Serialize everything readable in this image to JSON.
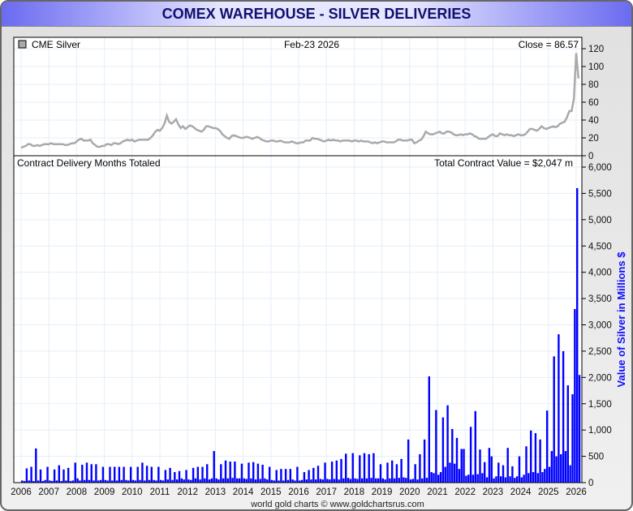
{
  "title": "COMEX WAREHOUSE - SILVER DELIVERIES",
  "footer": "world gold charts © www.goldchartsrus.com",
  "chart_data": [
    {
      "type": "line",
      "legend": "CME Silver",
      "date_label": "Feb-23  2026",
      "close_label": "Close = 86.57",
      "color": "#aaaaaa",
      "ylim": [
        0,
        120
      ],
      "yticks": [
        0,
        20,
        40,
        60,
        80,
        100,
        120
      ],
      "start_year": 2006,
      "monthly_values": [
        [
          9,
          10,
          11,
          13,
          13,
          11,
          11,
          12,
          11,
          12,
          13,
          13
        ],
        [
          13,
          14,
          13,
          13,
          13,
          13,
          13,
          12,
          12,
          13,
          14,
          14
        ],
        [
          16,
          18,
          19,
          17,
          17,
          17,
          18,
          14,
          12,
          10,
          10,
          11
        ],
        [
          11,
          13,
          13,
          12,
          14,
          14,
          13,
          14,
          16,
          17,
          18,
          17
        ],
        [
          18,
          16,
          17,
          18,
          18,
          18,
          18,
          18,
          20,
          23,
          27,
          29
        ],
        [
          28,
          31,
          36,
          45,
          38,
          36,
          38,
          41,
          35,
          31,
          33,
          30
        ],
        [
          32,
          34,
          33,
          31,
          29,
          28,
          27,
          29,
          33,
          33,
          32,
          31
        ],
        [
          31,
          30,
          28,
          24,
          22,
          20,
          19,
          22,
          23,
          22,
          21,
          20
        ],
        [
          20,
          21,
          21,
          20,
          19,
          20,
          21,
          20,
          18,
          17,
          16,
          16
        ],
        [
          17,
          17,
          16,
          16,
          17,
          16,
          15,
          15,
          15,
          16,
          15,
          14
        ],
        [
          14,
          15,
          15,
          17,
          17,
          17,
          20,
          19,
          19,
          18,
          17,
          16
        ],
        [
          17,
          18,
          17,
          18,
          17,
          17,
          16,
          17,
          17,
          17,
          17,
          16
        ],
        [
          17,
          17,
          16,
          17,
          16,
          16,
          16,
          15,
          14,
          15,
          14,
          15
        ],
        [
          16,
          16,
          15,
          15,
          15,
          15,
          16,
          18,
          18,
          17,
          17,
          17
        ],
        [
          18,
          18,
          14,
          15,
          17,
          18,
          22,
          27,
          25,
          24,
          24,
          25
        ],
        [
          26,
          27,
          25,
          25,
          27,
          27,
          26,
          24,
          23,
          23,
          24,
          23
        ],
        [
          24,
          24,
          25,
          24,
          22,
          21,
          19,
          19,
          19,
          19,
          21,
          23
        ],
        [
          24,
          22,
          22,
          25,
          24,
          23,
          24,
          23,
          23,
          22,
          23,
          24
        ],
        [
          23,
          23,
          24,
          27,
          30,
          30,
          29,
          28,
          30,
          33,
          31,
          30
        ],
        [
          31,
          32,
          33,
          32,
          33,
          36,
          37,
          38,
          43,
          50,
          50,
          64
        ],
        [
          115,
          86.57
        ]
      ]
    },
    {
      "type": "bar",
      "title": "Contract Delivery Months Totaled",
      "total_label": "Total Contract Value = $2,047 m",
      "ylabel": "Value of Silver in Millions $",
      "color": "#0000ff",
      "ylim": [
        0,
        6000
      ],
      "yticks": [
        "0",
        "500",
        "1,000",
        "1,500",
        "2,000",
        "2,500",
        "3,000",
        "3,500",
        "4,000",
        "4,500",
        "5,000",
        "5,500",
        "6,000"
      ],
      "xticks": [
        "2006",
        "2007",
        "2008",
        "2009",
        "2010",
        "2011",
        "2012",
        "2013",
        "2014",
        "2015",
        "2016",
        "2017",
        "2018",
        "2019",
        "2020",
        "2021",
        "2022",
        "2023",
        "2024",
        "2025",
        "2026"
      ],
      "start_year": 2006,
      "monthly_values": [
        [
          40,
          30,
          270,
          40,
          300,
          30,
          650,
          40,
          250,
          30,
          50,
          300
        ],
        [
          40,
          30,
          250,
          40,
          330,
          30,
          250,
          40,
          280,
          30,
          40,
          380
        ],
        [
          80,
          40,
          340,
          50,
          380,
          50,
          350,
          40,
          350,
          40,
          50,
          300
        ],
        [
          50,
          40,
          300,
          40,
          300,
          40,
          300,
          50,
          300,
          50,
          40,
          300
        ],
        [
          50,
          40,
          300,
          50,
          380,
          40,
          320,
          50,
          300,
          50,
          40,
          300
        ],
        [
          50,
          40,
          240,
          60,
          280,
          50,
          200,
          60,
          220,
          80,
          60,
          240
        ],
        [
          60,
          50,
          280,
          80,
          300,
          60,
          300,
          80,
          350,
          60,
          80,
          600
        ],
        [
          80,
          60,
          350,
          80,
          420,
          80,
          400,
          90,
          400,
          80,
          80,
          360
        ],
        [
          80,
          70,
          380,
          80,
          390,
          60,
          360,
          70,
          340,
          80,
          60,
          300
        ],
        [
          50,
          40,
          240,
          40,
          260,
          40,
          260,
          50,
          260,
          60,
          40,
          300
        ],
        [
          40,
          50,
          200,
          60,
          240,
          60,
          280,
          60,
          320,
          70,
          60,
          380
        ],
        [
          70,
          60,
          400,
          70,
          420,
          60,
          450,
          80,
          550,
          90,
          70,
          560
        ],
        [
          80,
          70,
          520,
          80,
          560,
          80,
          540,
          90,
          560,
          80,
          80,
          350
        ],
        [
          80,
          60,
          380,
          80,
          420,
          80,
          350,
          90,
          450,
          100,
          90,
          820
        ],
        [
          60,
          70,
          350,
          60,
          540,
          80,
          820,
          90,
          2020,
          200,
          180,
          1380
        ],
        [
          150,
          200,
          1240,
          300,
          1470,
          380,
          1020,
          360,
          850,
          260,
          640,
          640
        ],
        [
          130,
          150,
          1060,
          150,
          1360,
          160,
          630,
          180,
          390,
          100,
          660,
          500
        ],
        [
          80,
          120,
          380,
          120,
          330,
          100,
          660,
          120,
          310,
          90,
          120,
          500
        ],
        [
          100,
          150,
          690,
          180,
          990,
          200,
          940,
          180,
          820,
          200,
          260,
          1370
        ],
        [
          300,
          600,
          2400,
          500,
          2820,
          540,
          2500,
          600,
          1850,
          330,
          1680,
          3300
        ],
        [
          5600,
          2047
        ]
      ]
    }
  ]
}
